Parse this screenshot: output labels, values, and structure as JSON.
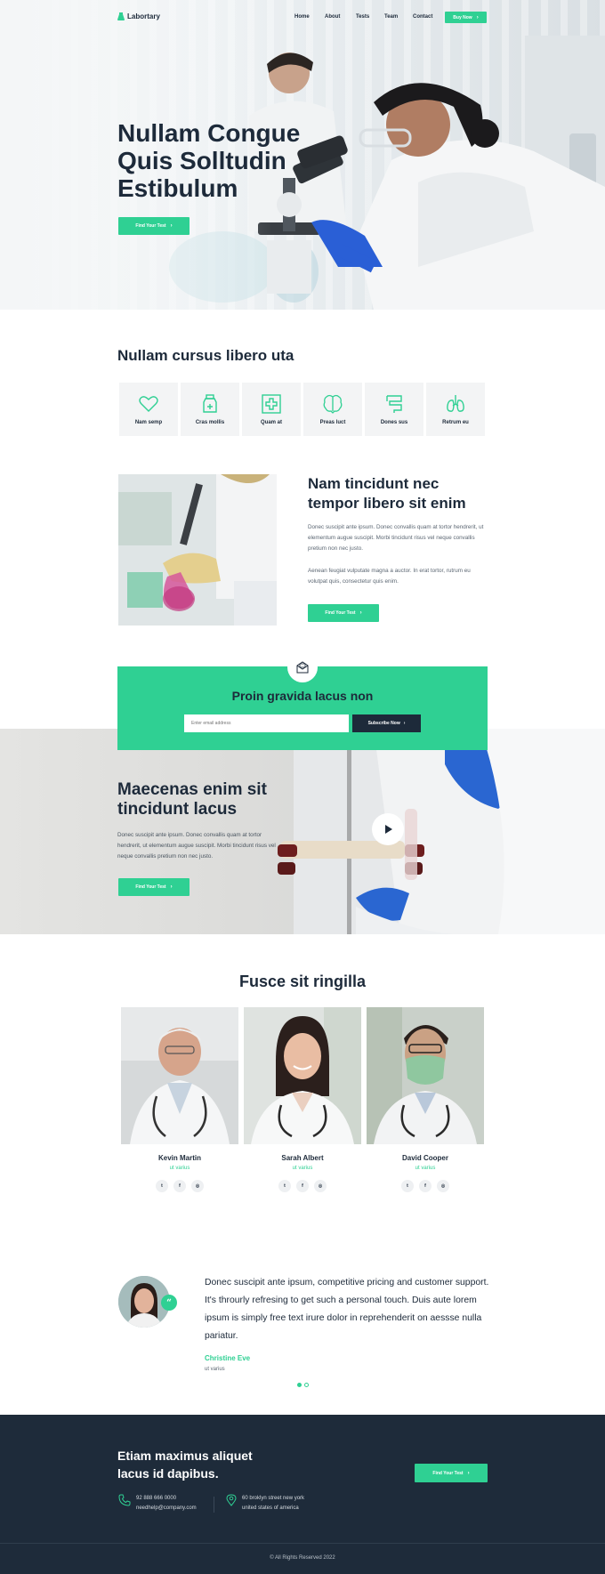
{
  "brand": {
    "name": "Labortary",
    "accent": "#2fd093",
    "dark": "#1e2b3a"
  },
  "nav": {
    "links": [
      "Home",
      "About",
      "Tests",
      "Team",
      "Contact"
    ],
    "cta": "Buy Now"
  },
  "hero": {
    "title_lines": [
      "Nullam Congue",
      "Quis Solltudin",
      "Estibulum"
    ],
    "button": "Find Your Test"
  },
  "services": {
    "title": "Nullam cursus libero uta",
    "items": [
      {
        "label": "Nam semp",
        "icon": "heart-icon"
      },
      {
        "label": "Cras mollis",
        "icon": "medicine-bottle-icon"
      },
      {
        "label": "Quam at",
        "icon": "medical-cross-icon"
      },
      {
        "label": "Preas luct",
        "icon": "brain-icon"
      },
      {
        "label": "Dones sus",
        "icon": "intestine-icon"
      },
      {
        "label": "Retrum eu",
        "icon": "lungs-icon"
      }
    ]
  },
  "about": {
    "title_lines": [
      "Nam tincidunt nec",
      "tempor libero sit enim"
    ],
    "p1": "Donec suscipit ante ipsum. Donec convallis quam at tortor hendrerit, ut elementum augue suscipit. Morbi tincidunt risus vel neque convallis pretium non nec justo.",
    "p2": "Aenean feugiat vulputate magna a auctor. In erat tortor, rutrum eu volutpat quis, consectetur quis enim.",
    "button": "Find Your Test"
  },
  "subscribe": {
    "title": "Proin gravida lacus non",
    "placeholder": "Enter email address",
    "button": "Subscribe Now"
  },
  "video": {
    "title_lines": [
      "Maecenas enim sit",
      "tincidunt lacus"
    ],
    "text": "Donec suscipit ante ipsum. Donec convallis quam at tortor hendrerit, ut elementum augue suscipit. Morbi tincidunt risus vel neque convallis pretium non nec justo.",
    "button": "Find Your Test"
  },
  "team": {
    "title": "Fusce sit ringilla",
    "members": [
      {
        "name": "Kevin Martin",
        "role": "ut varius"
      },
      {
        "name": "Sarah Albert",
        "role": "ut varius"
      },
      {
        "name": "David Cooper",
        "role": "ut varius"
      }
    ],
    "social": [
      "twitter-icon",
      "facebook-icon",
      "instagram-icon"
    ]
  },
  "testimonial": {
    "text": "Donec suscipit ante ipsum, competitive pricing and customer support. It's throurly refresing to get such a personal touch. Duis aute lorem ipsum is simply free text irure dolor in reprehenderit on aessse nulla pariatur.",
    "name": "Christine Eve",
    "role": "ut varius"
  },
  "footer": {
    "title_lines": [
      "Etiam maximus aliquet",
      "lacus id dapibus."
    ],
    "button": "Find Your Test",
    "phone": "92 888 666 0000",
    "email": "needhelp@company.com",
    "address_line1": "60 broklyn street new york",
    "address_line2": "united states of america",
    "copyright": "© All Rights Reserved 2022"
  }
}
